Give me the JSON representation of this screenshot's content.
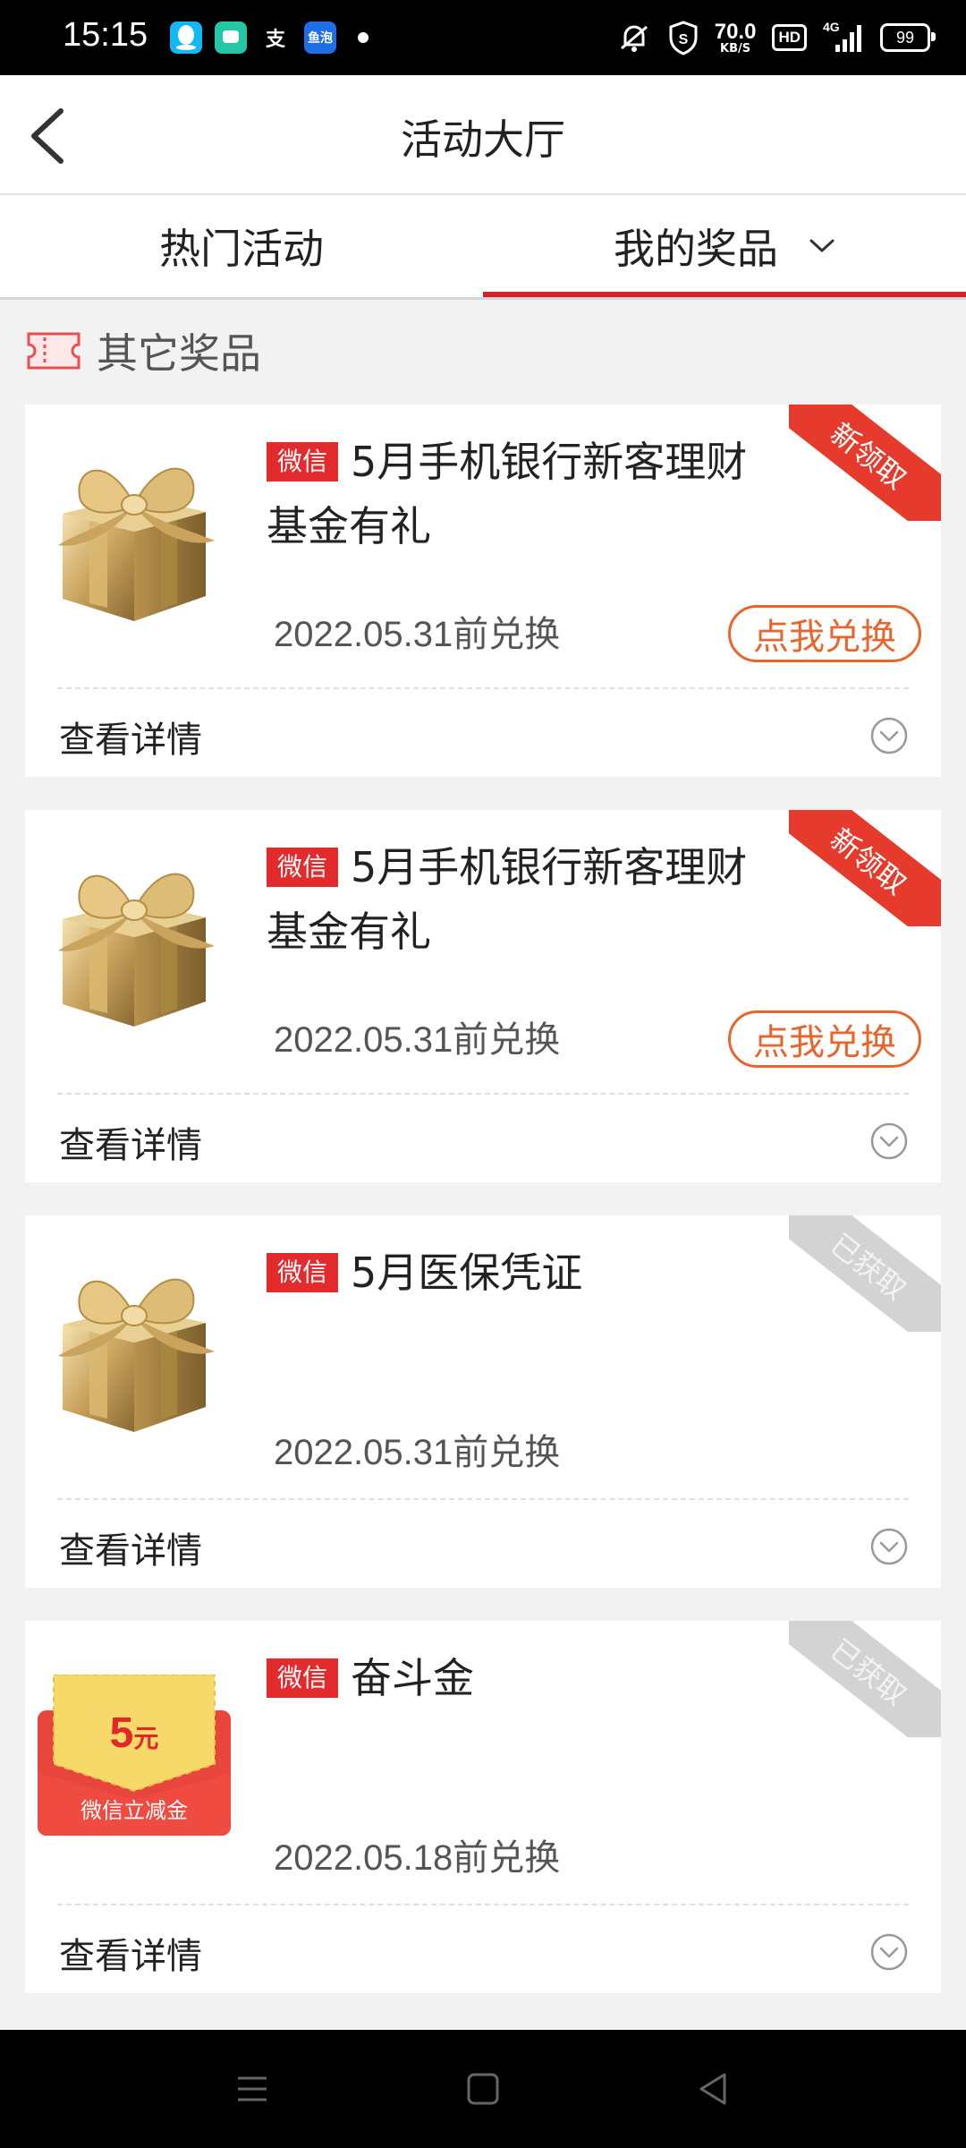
{
  "status_bar": {
    "time": "15:15",
    "apps": [
      {
        "icon": "qq-icon",
        "label": "",
        "bg": "#12b7f5"
      },
      {
        "icon": "messages-icon",
        "label": "",
        "bg": "#23c7a6"
      },
      {
        "icon": "alipay-icon",
        "label": "支",
        "bg": "#000000"
      },
      {
        "icon": "yupao-icon",
        "label": "鱼泡",
        "bg": "#1e6fe6"
      }
    ],
    "speed_value": "70.0",
    "speed_unit": "KB/S",
    "hd": "HD",
    "network": "4G",
    "battery": "99"
  },
  "header": {
    "title": "活动大厅"
  },
  "tabs": [
    {
      "label": "热门活动",
      "active": false
    },
    {
      "label": "我的奖品",
      "active": true
    }
  ],
  "section": {
    "label": "其它奖品"
  },
  "cards": [
    {
      "badge": "微信",
      "title": "5月手机银行新客理财基金有礼",
      "date": "2022.05.31前兑换",
      "button": "点我兑换",
      "ribbon": "新领取",
      "ribbon_type": "new",
      "detail": "查看详情",
      "image": "gift-box-icon"
    },
    {
      "badge": "微信",
      "title": "5月手机银行新客理财基金有礼",
      "date": "2022.05.31前兑换",
      "button": "点我兑换",
      "ribbon": "新领取",
      "ribbon_type": "new",
      "detail": "查看详情",
      "image": "gift-box-icon"
    },
    {
      "badge": "微信",
      "title": "5月医保凭证",
      "date": "2022.05.31前兑换",
      "button": "",
      "ribbon": "已获取",
      "ribbon_type": "got",
      "detail": "查看详情",
      "image": "gift-box-icon"
    },
    {
      "badge": "微信",
      "title": "奋斗金",
      "date": "2022.05.18前兑换",
      "button": "",
      "ribbon": "已获取",
      "ribbon_type": "got",
      "detail": "查看详情",
      "image": "red-envelope-icon",
      "envelope_amount": "5",
      "envelope_unit": "元",
      "envelope_caption": "微信立减金"
    }
  ],
  "colors": {
    "accent_red": "#d8202c",
    "exchange_orange": "#e8662b",
    "badge_red": "#e32a2d",
    "ribbon_gray": "#d3d3d3"
  }
}
